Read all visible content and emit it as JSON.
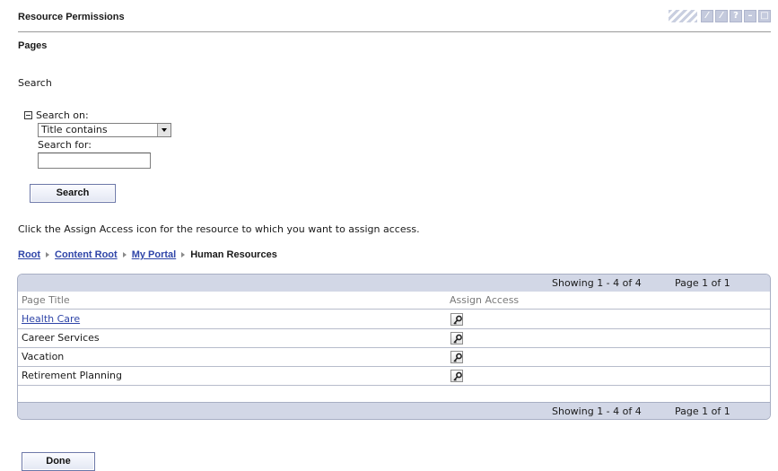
{
  "window": {
    "title": "Resource Permissions",
    "controls": [
      {
        "name": "edit-icon",
        "symbol": "⁄"
      },
      {
        "name": "configure-icon",
        "symbol": "⁄"
      },
      {
        "name": "help-icon",
        "symbol": "?"
      },
      {
        "name": "minimize-icon",
        "symbol": "–"
      },
      {
        "name": "maximize-icon",
        "symbol": "□"
      }
    ]
  },
  "section_title": "Pages",
  "search": {
    "heading": "Search",
    "search_on_label": "Search on:",
    "search_on_value": "Title contains",
    "search_for_label": "Search for:",
    "search_for_value": "",
    "button_label": "Search"
  },
  "instructions": "Click the Assign Access icon for the resource to which you want to assign access.",
  "breadcrumb": {
    "links": [
      "Root",
      "Content Root",
      "My Portal"
    ],
    "current": "Human Resources"
  },
  "table": {
    "showing": "Showing 1 - 4 of 4",
    "page": "Page 1 of 1",
    "columns": [
      "Page Title",
      "Assign Access"
    ],
    "rows": [
      {
        "title": "Health Care",
        "is_link": true
      },
      {
        "title": "Career Services",
        "is_link": false
      },
      {
        "title": "Vacation",
        "is_link": false
      },
      {
        "title": "Retirement Planning",
        "is_link": false
      }
    ]
  },
  "done_label": "Done",
  "colors": {
    "link": "#2f45a8",
    "grid_bar": "#d2d7e6",
    "button_border": "#6b77a8"
  }
}
